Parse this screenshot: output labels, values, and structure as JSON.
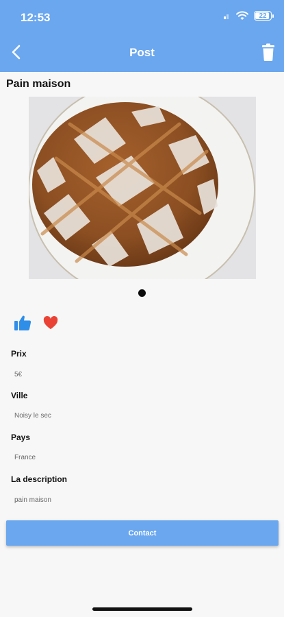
{
  "status_bar": {
    "time": "12:53",
    "battery": "22"
  },
  "header": {
    "title": "Post"
  },
  "post": {
    "title": "Pain maison",
    "fields": [
      {
        "label": "Prix",
        "value": "5€"
      },
      {
        "label": "Ville",
        "value": "Noisy le sec"
      },
      {
        "label": "Pays",
        "value": "France"
      },
      {
        "label": "La description",
        "value": "pain maison"
      }
    ]
  },
  "actions": {
    "contact_label": "Contact"
  },
  "icons": {
    "back": "chevron-left-icon",
    "trash": "trash-icon",
    "like": "thumbs-up-icon",
    "favorite": "heart-icon"
  },
  "colors": {
    "accent": "#6aa7ef",
    "like": "#2f8ee8",
    "heart": "#ea4335"
  }
}
